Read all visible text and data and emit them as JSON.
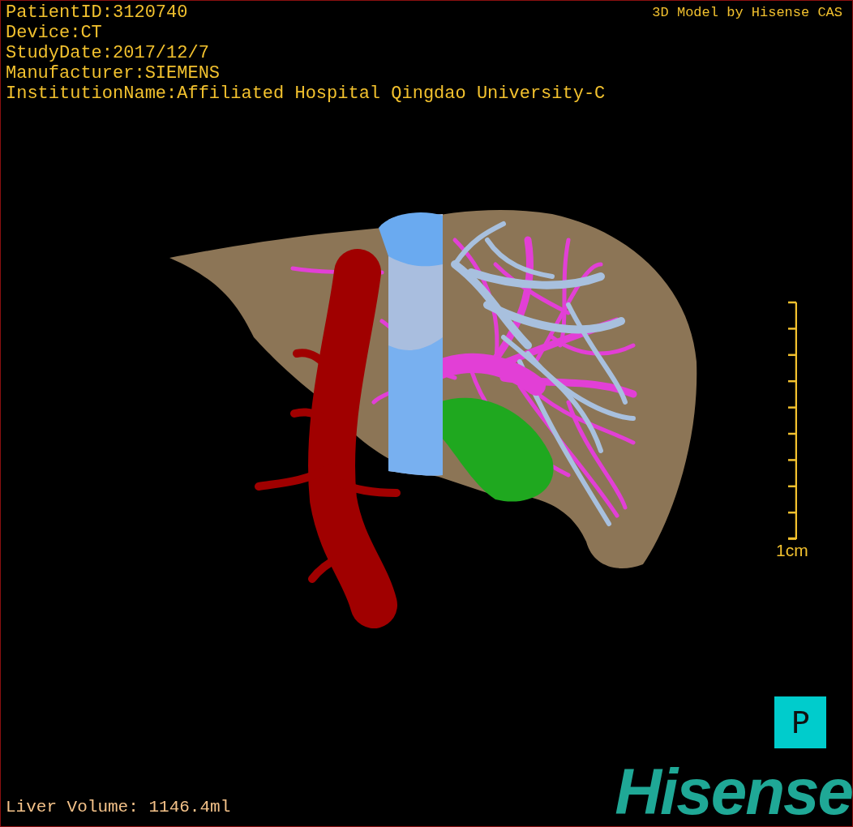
{
  "info_lines": [
    "PatientID:3120740",
    "Device:CT",
    "StudyDate:2017/12/7",
    "Manufacturer:SIEMENS",
    "InstitutionName:Affiliated Hospital Qingdao University-C"
  ],
  "title": "3D Model by Hisense CAS",
  "scale": {
    "label": "1cm"
  },
  "liver_volume": "Liver Volume: 1146.4ml",
  "orientation_button": "P",
  "logo": "Hisense"
}
